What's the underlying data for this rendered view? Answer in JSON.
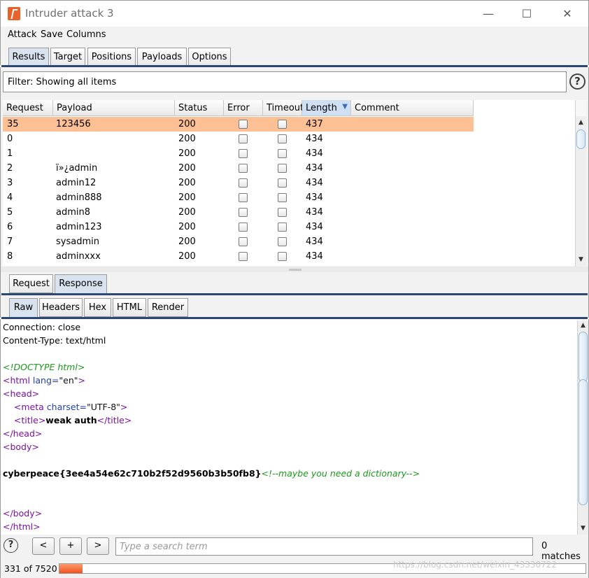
{
  "window": {
    "title": "Intruder attack 3",
    "minimize": "—",
    "maximize": "☐",
    "close": "✕"
  },
  "menu": [
    "Attack",
    "Save",
    "Columns"
  ],
  "tabs": [
    "Results",
    "Target",
    "Positions",
    "Payloads",
    "Options"
  ],
  "filter": {
    "text": "Filter: Showing all items",
    "help": "?"
  },
  "table": {
    "headers": [
      "Request",
      "Payload",
      "Status",
      "Error",
      "Timeout",
      "Length",
      "Comment"
    ],
    "sort_indicator": "▼",
    "rows": [
      {
        "request": "35",
        "payload": "123456",
        "status": "200",
        "length": "437",
        "selected": true
      },
      {
        "request": "0",
        "payload": "",
        "status": "200",
        "length": "434",
        "selected": false
      },
      {
        "request": "1",
        "payload": "",
        "status": "200",
        "length": "434",
        "selected": false
      },
      {
        "request": "2",
        "payload": "ï»¿admin",
        "status": "200",
        "length": "434",
        "selected": false
      },
      {
        "request": "3",
        "payload": "admin12",
        "status": "200",
        "length": "434",
        "selected": false
      },
      {
        "request": "4",
        "payload": "admin888",
        "status": "200",
        "length": "434",
        "selected": false
      },
      {
        "request": "5",
        "payload": "admin8",
        "status": "200",
        "length": "434",
        "selected": false
      },
      {
        "request": "6",
        "payload": "admin123",
        "status": "200",
        "length": "434",
        "selected": false
      },
      {
        "request": "7",
        "payload": "sysadmin",
        "status": "200",
        "length": "434",
        "selected": false
      },
      {
        "request": "8",
        "payload": "adminxxx",
        "status": "200",
        "length": "434",
        "selected": false
      }
    ]
  },
  "reqres_tabs": [
    "Request",
    "Response"
  ],
  "view_tabs": [
    "Raw",
    "Headers",
    "Hex",
    "HTML",
    "Render"
  ],
  "response": {
    "connection": "Connection: close",
    "content_type": "Content-Type: text/html",
    "doctype": "<!DOCTYPE html>",
    "html_open": "<html",
    "html_lang_attr": " lang=",
    "html_lang_val": "\"en\"",
    "html_close_bracket": ">",
    "head_open": "<head>",
    "meta_open": "<meta",
    "meta_attr": " charset=",
    "meta_val": "\"UTF-8\"",
    "meta_close": ">",
    "title_open": "<title>",
    "title_text": "weak auth",
    "title_close": "</title>",
    "head_close": "</head>",
    "body_open": "<body>",
    "flag": "cyberpeace{3ee4a54e62c710b2f52d9560b3b50fb8}",
    "flag_comment": "<!--maybe you need a dictionary-->",
    "body_close": "</body>",
    "html_close": "</html>"
  },
  "search": {
    "help": "?",
    "prev": "<",
    "add": "+",
    "next": ">",
    "placeholder": "Type a search term",
    "matches": "0 matches"
  },
  "status": {
    "count": "331 of 7520",
    "progress_fraction": 0.044
  },
  "watermark": "https://blog.csdn.net/weixin_43330722"
}
